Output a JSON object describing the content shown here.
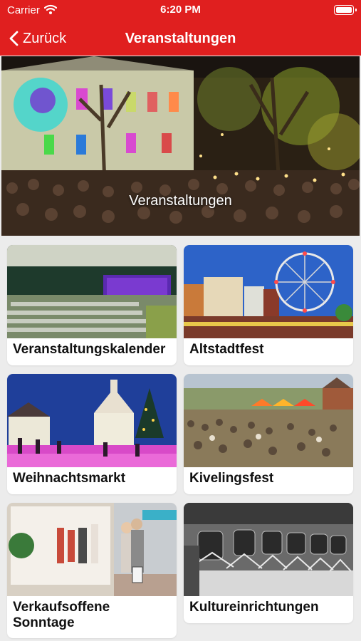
{
  "status_bar": {
    "carrier": "Carrier",
    "time": "6:20 PM"
  },
  "nav": {
    "back_label": "Zurück",
    "title": "Veranstaltungen"
  },
  "hero": {
    "title": "Veranstaltungen"
  },
  "tiles": [
    {
      "label": "Veranstaltungskalender"
    },
    {
      "label": "Altstadtfest"
    },
    {
      "label": "Weihnachtsmarkt"
    },
    {
      "label": "Kivelingsfest"
    },
    {
      "label": "Verkaufsoffene Sonntage"
    },
    {
      "label": "Kultureinrichtungen"
    }
  ],
  "colors": {
    "brand_red": "#e01f1f",
    "background": "#ececec",
    "card": "#ffffff"
  },
  "icons": {
    "back": "chevron-left-icon",
    "wifi": "wifi-icon",
    "battery": "battery-icon"
  }
}
